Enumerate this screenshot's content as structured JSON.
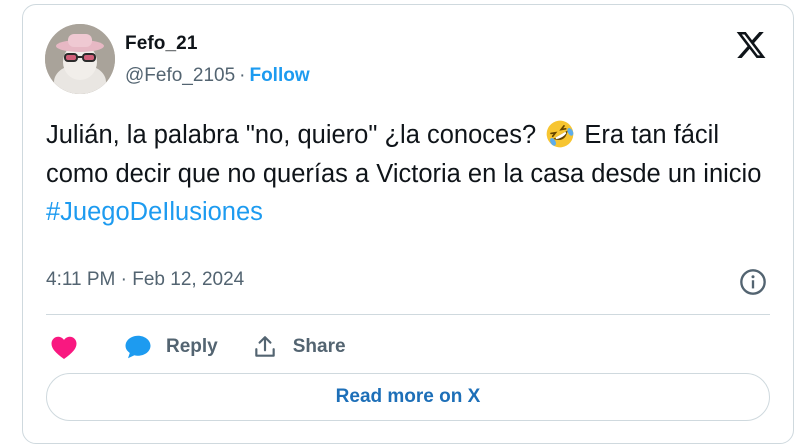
{
  "author": {
    "display_name": "Fefo_21",
    "handle": "@Fefo_2105",
    "separator": "·",
    "follow_label": "Follow"
  },
  "tweet": {
    "text_part1": "Julián, la palabra \"no, quiero\" ¿la conoces?",
    "emoji": "rolling-on-floor-laughing",
    "text_part2": "Era tan fácil como decir que no querías a Victoria en la casa desde un inicio",
    "hashtag": "#JuegoDeIlusiones",
    "timestamp": "4:11 PM · Feb 12, 2024"
  },
  "actions": {
    "like_icon": "heart-icon",
    "reply_label": "Reply",
    "share_label": "Share"
  },
  "read_more_label": "Read more on X",
  "colors": {
    "accent": "#1d9bf0",
    "like": "#f91880",
    "secondary_text": "#536471",
    "border": "#cfd9de"
  }
}
